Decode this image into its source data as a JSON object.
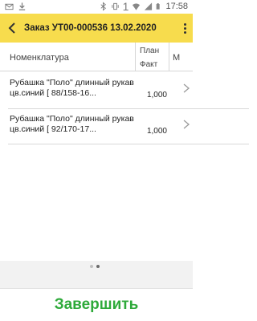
{
  "statusbar": {
    "sim": "1",
    "time": "17:58"
  },
  "appbar": {
    "title": "Заказ УТ00-000536  13.02.2020"
  },
  "table": {
    "headers": {
      "nomenclature": "Номенклатура",
      "plan": "План",
      "fact": "Факт",
      "m": "М"
    },
    "rows": [
      {
        "name": "Рубашка \"Поло\" длинный рукав цв.синий [  88/158-16...",
        "fact": "1,000"
      },
      {
        "name": "Рубашка \"Поло\" длинный рукав цв.синий [  92/170-17...",
        "fact": "1,000"
      }
    ]
  },
  "pager": {
    "pages": 2,
    "active_page": 2
  },
  "footer": {
    "finish_label": "Завершить"
  },
  "colors": {
    "appbar": "#f7dc4d",
    "finish": "#2eaa3a"
  }
}
